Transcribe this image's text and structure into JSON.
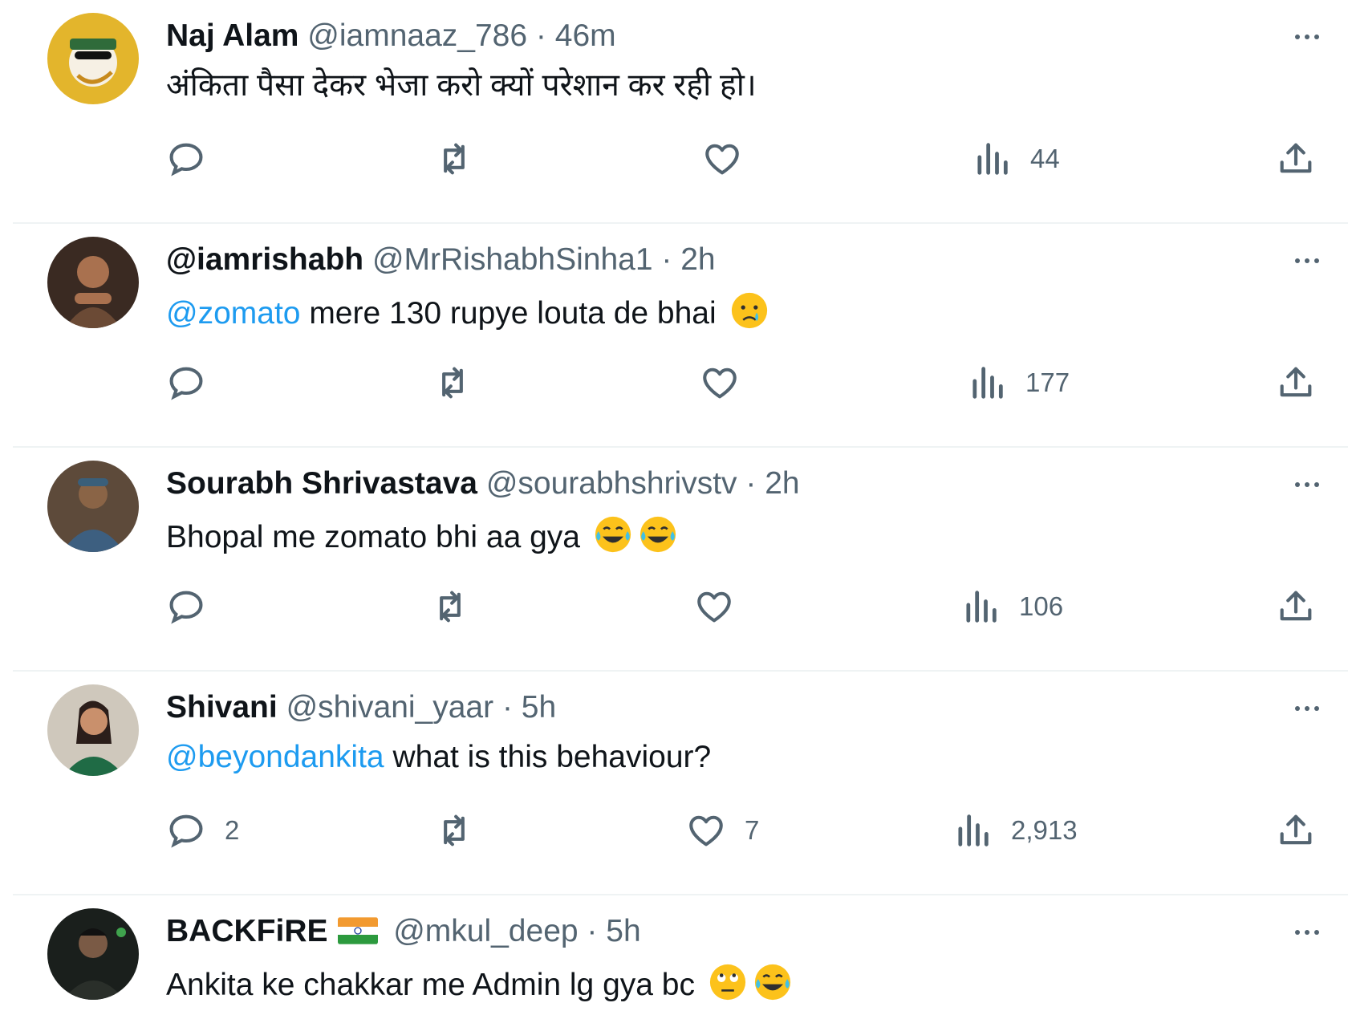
{
  "tweets": [
    {
      "name": "Naj Alam",
      "handle": "@iamnaaz_786",
      "dot": "·",
      "time": "46m",
      "text": "अंकिता पैसा देकर भेजा करो क्यों परेशान कर रही हो।",
      "actions": {
        "replies": "",
        "retweets": "",
        "likes": "",
        "views": "44"
      }
    },
    {
      "name": "@iamrishabh",
      "handle": "@MrRishabhSinha1",
      "dot": "·",
      "time": "2h",
      "mention": "@zomato",
      "text": " mere 130 rupye louta de bhai",
      "emojis": [
        "crying-face-emoji"
      ],
      "actions": {
        "replies": "",
        "retweets": "",
        "likes": "",
        "views": "177"
      }
    },
    {
      "name": "Sourabh Shrivastava",
      "handle": "@sourabhshrivstv",
      "dot": "·",
      "time": "2h",
      "text": "Bhopal me zomato bhi aa gya",
      "emojis": [
        "tears-of-joy-emoji",
        "tears-of-joy-emoji"
      ],
      "actions": {
        "replies": "",
        "retweets": "",
        "likes": "",
        "views": "106"
      }
    },
    {
      "name": "Shivani",
      "handle": "@shivani_yaar",
      "dot": "·",
      "time": "5h",
      "mention": "@beyondankita",
      "text": " what is this behaviour?",
      "actions": {
        "replies": "2",
        "retweets": "",
        "likes": "7",
        "views": "2,913"
      }
    },
    {
      "name": "BACKFiRE",
      "name_flag": "india-flag-emoji",
      "handle": "@mkul_deep",
      "dot": "·",
      "time": "5h",
      "text": "Ankita ke chakkar me Admin lg gya bc",
      "emojis": [
        "eye-roll-emoji",
        "tears-of-joy-emoji"
      ]
    }
  ],
  "colors": {
    "text": "#0f1419",
    "secondary": "#536471",
    "link": "#1d9bf0",
    "divider": "#eff3f4"
  }
}
